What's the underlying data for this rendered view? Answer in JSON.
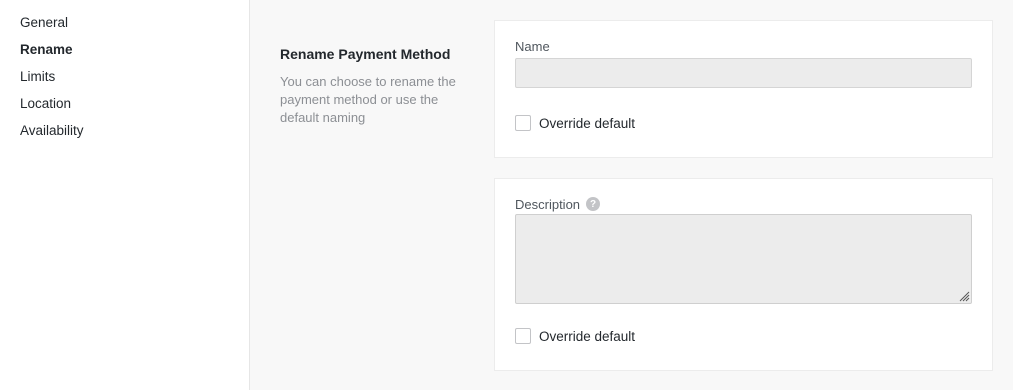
{
  "sidebar": {
    "items": [
      {
        "label": "General",
        "active": false
      },
      {
        "label": "Rename",
        "active": true
      },
      {
        "label": "Limits",
        "active": false
      },
      {
        "label": "Location",
        "active": false
      },
      {
        "label": "Availability",
        "active": false
      }
    ]
  },
  "section": {
    "title": "Rename Payment Method",
    "description": "You can choose to rename the payment method or use the default naming"
  },
  "name_field": {
    "label": "Name",
    "value": "",
    "override_label": "Override default",
    "override_checked": false
  },
  "description_field": {
    "label": "Description",
    "help_icon": "question-circle-icon",
    "value": "",
    "override_label": "Override default",
    "override_checked": false
  },
  "colors": {
    "sidebar_bg": "#ffffff",
    "content_bg": "#f8f8f8",
    "input_bg": "#ececec"
  }
}
